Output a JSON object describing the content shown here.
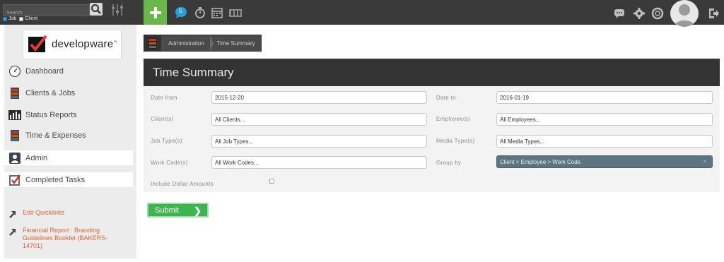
{
  "topbar": {
    "search_placeholder": "Search",
    "scope": [
      {
        "label": "Job",
        "checked": true
      },
      {
        "label": "Client",
        "checked": false
      }
    ],
    "notification_count": "5"
  },
  "sidebar": {
    "logo_text": "developware",
    "logo_tm": "™",
    "nav": [
      {
        "label": "Dashboard",
        "icon": "dashboard-gauge-icon"
      },
      {
        "label": "Clients & Jobs",
        "icon": "clients-jobs-icon"
      },
      {
        "label": "Status Reports",
        "icon": "bar-chart-icon"
      },
      {
        "label": "Time & Expenses",
        "icon": "time-expenses-icon"
      },
      {
        "label": "Admin",
        "icon": "admin-person-icon"
      },
      {
        "label": "Completed Tasks",
        "icon": "checkbox-icon"
      }
    ],
    "quicklinks": {
      "edit_label": "Edit Quicklinks",
      "items": [
        "Financial Report : Branding Guidelines Booklet (BAKERS-14701)"
      ]
    }
  },
  "breadcrumb": [
    "Administration",
    "Time Summary"
  ],
  "panel": {
    "title": "Time Summary",
    "fields": {
      "date_from": {
        "label": "Date from",
        "value": "2015-12-20"
      },
      "date_to": {
        "label": "Date to",
        "value": "2016-01-19"
      },
      "clients": {
        "label": "Client(s)",
        "value": "All Clients..."
      },
      "employees": {
        "label": "Employee(s)",
        "value": "All Employees..."
      },
      "job_types": {
        "label": "Job Type(s)",
        "value": "All Job Types..."
      },
      "media_types": {
        "label": "Media Type(s)",
        "value": "All Media Types..."
      },
      "work_codes": {
        "label": "Work Code(s)",
        "value": "All Work Codes..."
      },
      "group_by": {
        "label": "Group by",
        "value": "Client > Employee > Work Code"
      },
      "include_dollar": {
        "label": "Include Dollar Amounts",
        "checked": false
      }
    },
    "submit_label": "Submit"
  },
  "colors": {
    "topbar": "#3a3a3a",
    "add_button": "#6ab84c",
    "submit": "#3fb34f",
    "group_by_select": "#5c7580",
    "quicklink": "#e0643a"
  }
}
